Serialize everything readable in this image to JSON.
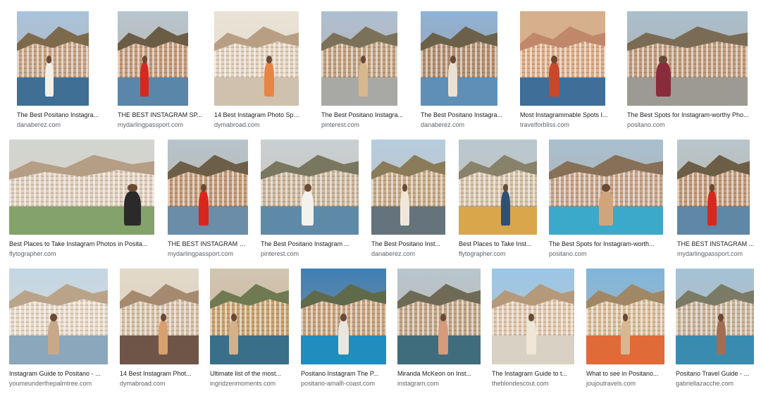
{
  "results": [
    {
      "title": "The Best Positano Instagra...",
      "source": "danaberez.com",
      "colors": {
        "sky": "#a9c3dc",
        "cliff": "#7d6a4d",
        "town": "#c9a585",
        "ground": "#3f6f95",
        "person": "#f3f0ea"
      }
    },
    {
      "title": "THE BEST INSTAGRAM SP...",
      "source": "mydarlingpassport.com",
      "colors": {
        "sky": "#b7c6cf",
        "cliff": "#6a5c45",
        "town": "#c59b7a",
        "ground": "#5a86a9",
        "person": "#d6281e"
      }
    },
    {
      "title": "14 Best Instagram Photo Spot...",
      "source": "dymabroad.com",
      "colors": {
        "sky": "#e9e2d6",
        "cliff": "#b89f84",
        "town": "#e4d2bd",
        "ground": "#cfc1ad",
        "person": "#e88544"
      }
    },
    {
      "title": "The Best Positano Instagra...",
      "source": "pinterest.com",
      "colors": {
        "sky": "#aebfd2",
        "cliff": "#7b7058",
        "town": "#c3a17f",
        "ground": "#a8a9a4",
        "person": "#d7b88e"
      }
    },
    {
      "title": "The Best Positano Instagra...",
      "source": "danaberez.com",
      "colors": {
        "sky": "#8fb2d6",
        "cliff": "#6b614a",
        "town": "#b48f6f",
        "ground": "#5f8fb6",
        "person": "#e9e1d4"
      }
    },
    {
      "title": "Most Instagrammable Spots I...",
      "source": "travelforbliss.com",
      "colors": {
        "sky": "#d5b08c",
        "cliff": "#c0876a",
        "town": "#deae88",
        "ground": "#3f6e98",
        "person": "#c9482b"
      }
    },
    {
      "title": "The Best Spots for Instagram-worthy Pho...",
      "source": "positano.com",
      "colors": {
        "sky": "#a9bfce",
        "cliff": "#7a6b55",
        "town": "#c19c7c",
        "ground": "#9d9a94",
        "person": "#8a2b3c"
      }
    },
    {
      "title": "Best Places to Take Instagram Photos in Posita...",
      "source": "flytographer.com",
      "colors": {
        "sky": "#d2d5d0",
        "cliff": "#b49e86",
        "town": "#e1cfbc",
        "ground": "#83a36a",
        "person": "#2b2a2b"
      }
    },
    {
      "title": "THE BEST INSTAGRAM S...",
      "source": "mydarlingpassport.com",
      "colors": {
        "sky": "#b6c5cc",
        "cliff": "#6d5f47",
        "town": "#c49a78",
        "ground": "#6b8da8",
        "person": "#d9261d"
      }
    },
    {
      "title": "The Best Positano Instagram ...",
      "source": "pinterest.com",
      "colors": {
        "sky": "#c9cfd2",
        "cliff": "#7a7761",
        "town": "#cdb79c",
        "ground": "#5f8aa7",
        "person": "#f4f2ee"
      }
    },
    {
      "title": "The Best Positano Inst...",
      "source": "danaberez.com",
      "colors": {
        "sky": "#b7cde0",
        "cliff": "#8a7b59",
        "town": "#c9ac89",
        "ground": "#65737c",
        "person": "#efe8da"
      }
    },
    {
      "title": "Best Places to Take Inst...",
      "source": "flytographer.com",
      "colors": {
        "sky": "#b8c7cf",
        "cliff": "#88826a",
        "town": "#d7c3a9",
        "ground": "#d9a64b",
        "person": "#2f4f74"
      }
    },
    {
      "title": "The Best Spots for Instagram-worth...",
      "source": "positano.com",
      "colors": {
        "sky": "#a8bfcf",
        "cliff": "#867057",
        "town": "#c8a58a",
        "ground": "#3ba9c9",
        "person": "#cfa57c"
      }
    },
    {
      "title": "THE BEST INSTAGRAM ...",
      "source": "mydarlingpassport.com",
      "colors": {
        "sky": "#b8c6cc",
        "cliff": "#6c5e46",
        "town": "#c39a79",
        "ground": "#5f87a6",
        "person": "#d7281f"
      }
    },
    {
      "title": "Instagram Guide to Positano - ...",
      "source": "youmeunderthepalmtree.com",
      "colors": {
        "sky": "#c4d7e4",
        "cliff": "#b9a48a",
        "town": "#e8d8c5",
        "ground": "#8aa7bb",
        "person": "#c8a88a"
      }
    },
    {
      "title": "14 Best Instagram Phot...",
      "source": "dymabroad.com",
      "colors": {
        "sky": "#e2d9ca",
        "cliff": "#a58a70",
        "town": "#d8c2a9",
        "ground": "#6f5548",
        "person": "#d7a06e"
      }
    },
    {
      "title": "Ultimate list of the most...",
      "source": "ingridzenmoments.com",
      "colors": {
        "sky": "#d1c5b3",
        "cliff": "#6f7a52",
        "town": "#c9a36f",
        "ground": "#3a6f89",
        "person": "#d4b18a"
      }
    },
    {
      "title": "Positano Instagram The P...",
      "source": "positano-amalfi-coast.com",
      "colors": {
        "sky": "#3f7fb5",
        "cliff": "#5f6a4b",
        "town": "#c9a37d",
        "ground": "#1f8ebf",
        "person": "#e9e6df"
      }
    },
    {
      "title": "Miranda McKeon on Inst...",
      "source": "instagram.com",
      "colors": {
        "sky": "#b8c6cf",
        "cliff": "#6f6a55",
        "town": "#c3a686",
        "ground": "#3f6d7d",
        "person": "#d59b7a"
      }
    },
    {
      "title": "The Instagram Guide to t...",
      "source": "theblondescout.com",
      "colors": {
        "sky": "#9ac6e6",
        "cliff": "#b5997b",
        "town": "#e2c8ad",
        "ground": "#d9d1c3",
        "person": "#efe6d6"
      }
    },
    {
      "title": "What to see in Positano...",
      "source": "joujoutravels.com",
      "colors": {
        "sky": "#7fb5db",
        "cliff": "#a08866",
        "town": "#dbbf9b",
        "ground": "#e06a38",
        "person": "#d8b691"
      }
    },
    {
      "title": "Positano Travel Guide - ...",
      "source": "gabriellazacche.com",
      "colors": {
        "sky": "#a4c2d6",
        "cliff": "#7a7a65",
        "town": "#cab49b",
        "ground": "#3a8bb0",
        "person": "#a26d55"
      }
    }
  ]
}
